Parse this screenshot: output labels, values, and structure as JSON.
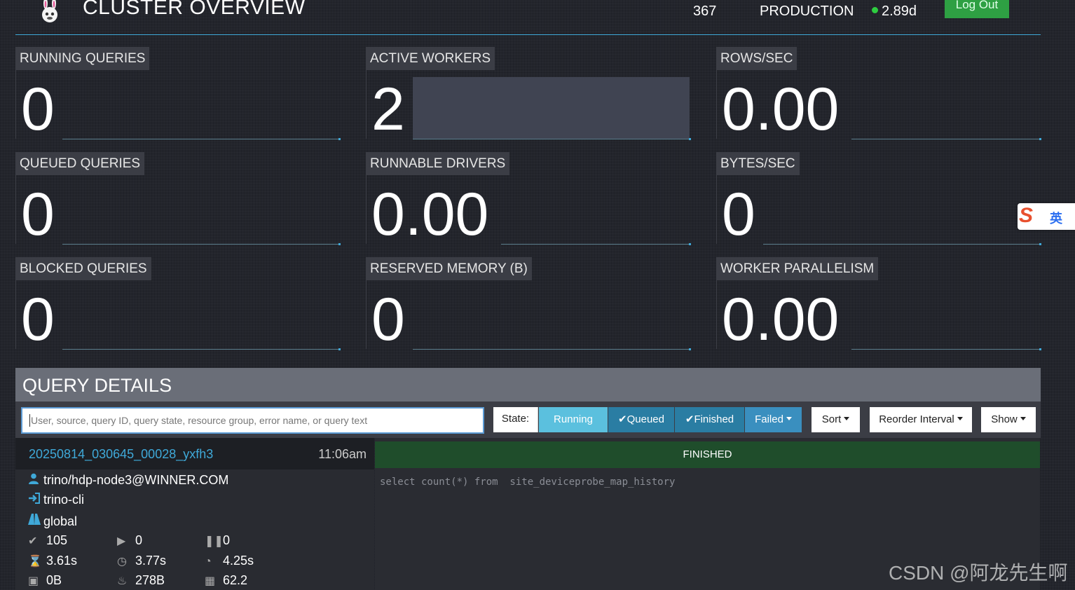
{
  "header": {
    "title": "CLUSTER OVERVIEW",
    "version": "367",
    "environment": "PRODUCTION",
    "uptime": "2.89d",
    "logout_label": "Log Out"
  },
  "tiles": [
    {
      "label": "RUNNING QUERIES",
      "value": "0"
    },
    {
      "label": "ACTIVE WORKERS",
      "value": "2"
    },
    {
      "label": "ROWS/SEC",
      "value": "0.00"
    },
    {
      "label": "QUEUED QUERIES",
      "value": "0"
    },
    {
      "label": "RUNNABLE DRIVERS",
      "value": "0.00"
    },
    {
      "label": "BYTES/SEC",
      "value": "0"
    },
    {
      "label": "BLOCKED QUERIES",
      "value": "0"
    },
    {
      "label": "RESERVED MEMORY (B)",
      "value": "0"
    },
    {
      "label": "WORKER PARALLELISM",
      "value": "0.00"
    }
  ],
  "query_details": {
    "title": "QUERY DETAILS",
    "search_placeholder": "User, source, query ID, query state, resource group, error name, or query text",
    "state_label": "State:",
    "filters": {
      "running": "Running",
      "queued": "Queued",
      "finished": "Finished",
      "failed": "Failed"
    },
    "sort_label": "Sort",
    "reorder_label": "Reorder Interval",
    "show_label": "Show"
  },
  "query": {
    "id": "20250814_030645_00028_yxfh3",
    "time": "11:06am",
    "user": "trino/hdp-node3@WINNER.COM",
    "source": "trino-cli",
    "resource_group": "global",
    "state": "FINISHED",
    "sql": "select count(*) from  site_deviceprobe_map_history",
    "metrics": {
      "completed_splits": "105",
      "running_splits": "0",
      "queued_splits": "0",
      "wall_time": "3.61s",
      "elapsed_time": "3.77s",
      "cpu_time": "4.25s",
      "memory": "0B",
      "peak_memory": "278B",
      "rows_per_sec": "62.2"
    }
  },
  "ime": {
    "logo": "S",
    "mode": "英"
  },
  "watermark": "CSDN @阿龙先生啊",
  "colors": {
    "accent": "#3fa9d9",
    "running": "#5bc0de",
    "queued": "#2a7da3",
    "finished_state": "#1f4d2b",
    "logout": "#2ea043"
  }
}
